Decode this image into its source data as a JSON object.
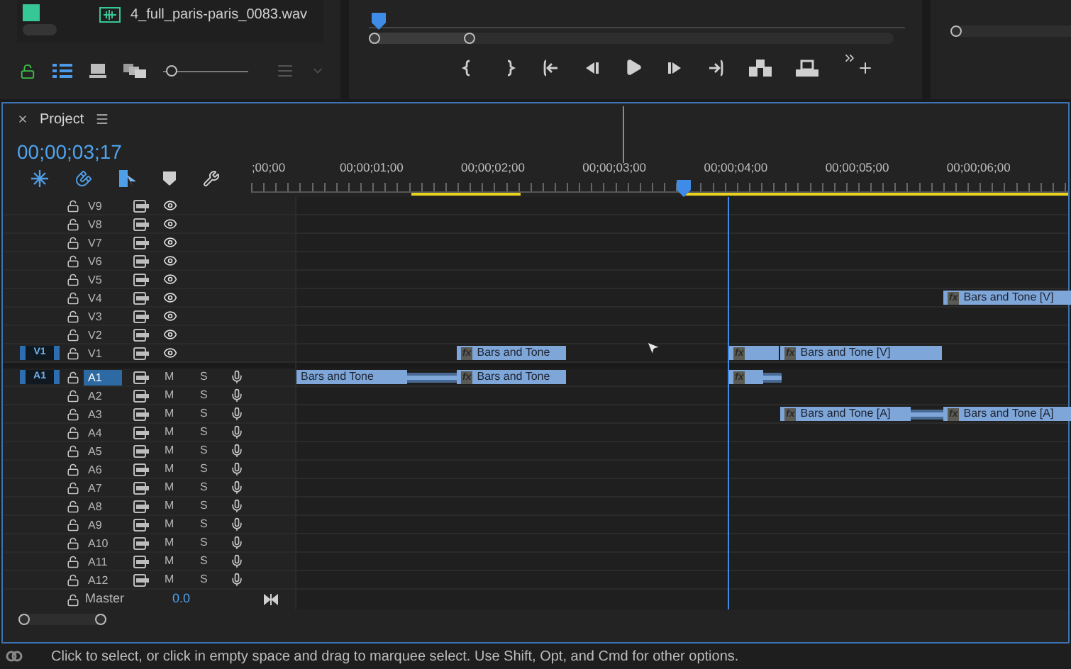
{
  "media_item": {
    "name": "4_full_paris-paris_0083.wav"
  },
  "thumbnail_zoom": {
    "level": 0.04
  },
  "timeline": {
    "tab": "Project",
    "timecode": "00;00;03;17",
    "ruler_labels": [
      ";00;00",
      "00;00;01;00",
      "00;00;02;00",
      "00;00;03;00",
      "00;00;04;00",
      "00;00;05;00",
      "00;00;06;00"
    ],
    "video_tracks": [
      {
        "name": "V9",
        "selected": false
      },
      {
        "name": "V8",
        "selected": false
      },
      {
        "name": "V7",
        "selected": false
      },
      {
        "name": "V6",
        "selected": false
      },
      {
        "name": "V5",
        "selected": false
      },
      {
        "name": "V4",
        "selected": false,
        "clips": [
          {
            "effect_badge": "fx",
            "label": "Bars and Tone [V]"
          }
        ]
      },
      {
        "name": "V3",
        "selected": false
      },
      {
        "name": "V2",
        "selected": false
      },
      {
        "name": "V1",
        "selected": false,
        "source": "V1",
        "clips": [
          {
            "effect_badge": "fx",
            "label": "Bars and Tone"
          },
          {
            "effect_badge": "fx"
          },
          {
            "effect_badge": "fx",
            "label": "Bars and Tone [V]"
          }
        ]
      }
    ],
    "audio_tracks": [
      {
        "name": "A1",
        "selected": true,
        "source": "A1",
        "mute": "M",
        "solo": "S",
        "clips": [
          {
            "label": "Bars and Tone"
          },
          {
            "effect_badge": "fx",
            "label": "Bars and Tone"
          },
          {
            "effect_badge": "fx"
          }
        ]
      },
      {
        "name": "A2",
        "selected": false,
        "mute": "M",
        "solo": "S"
      },
      {
        "name": "A3",
        "selected": false,
        "mute": "M",
        "solo": "S",
        "clips": [
          {
            "effect_badge": "fx",
            "label": "Bars and Tone [A]"
          },
          {
            "effect_badge": "fx",
            "label": "Bars and Tone [A]"
          }
        ]
      },
      {
        "name": "A4",
        "selected": false,
        "mute": "M",
        "solo": "S"
      },
      {
        "name": "A5",
        "selected": false,
        "mute": "M",
        "solo": "S"
      },
      {
        "name": "A6",
        "selected": false,
        "mute": "M",
        "solo": "S"
      },
      {
        "name": "A7",
        "selected": false,
        "mute": "M",
        "solo": "S"
      },
      {
        "name": "A8",
        "selected": false,
        "mute": "M",
        "solo": "S"
      },
      {
        "name": "A9",
        "selected": false,
        "mute": "M",
        "solo": "S"
      },
      {
        "name": "A10",
        "selected": false,
        "mute": "M",
        "solo": "S"
      },
      {
        "name": "A11",
        "selected": false,
        "mute": "M",
        "solo": "S"
      },
      {
        "name": "A12",
        "selected": false,
        "mute": "M",
        "solo": "S"
      }
    ],
    "master": {
      "name": "Master",
      "value": "0.0"
    }
  },
  "status_bar": "Click to select, or click in empty space and drag to marquee select. Use Shift, Opt, and Cmd for other options."
}
